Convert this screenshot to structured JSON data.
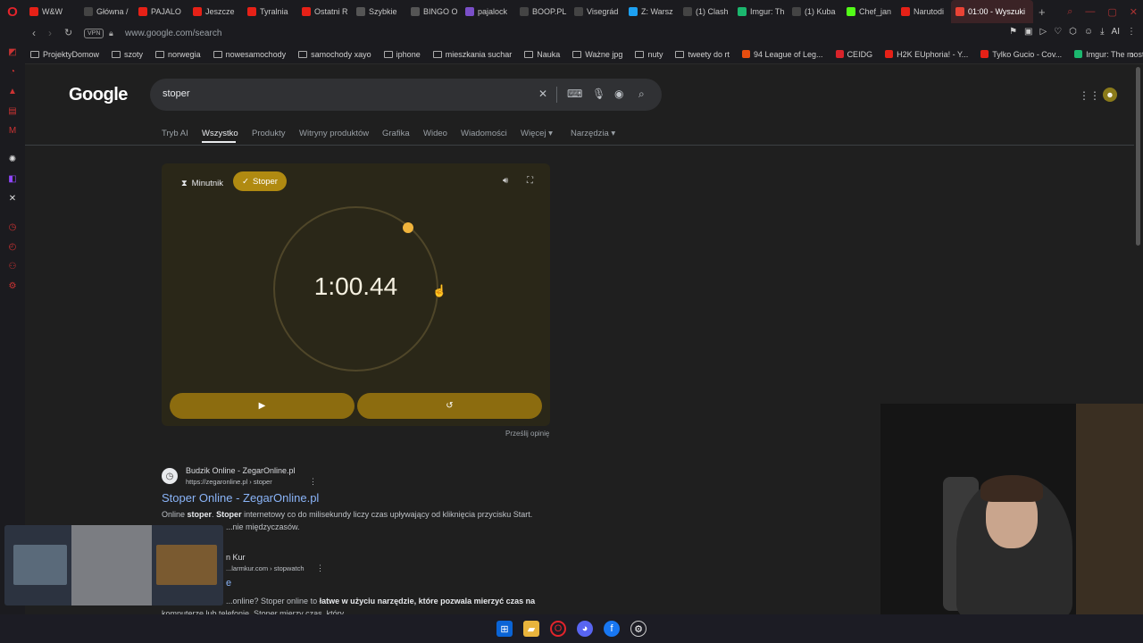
{
  "browser": {
    "tabs": [
      {
        "label": "W&W",
        "color": "#e62117",
        "icon": "youtube-icon"
      },
      {
        "label": "Główna /",
        "color": "#444",
        "icon": "x-icon"
      },
      {
        "label": "PAJALO",
        "color": "#e62117",
        "icon": "youtube-icon"
      },
      {
        "label": "Jeszcze",
        "color": "#e62117",
        "icon": "youtube-icon"
      },
      {
        "label": "Tyralnia",
        "color": "#e62117",
        "icon": "youtube-icon"
      },
      {
        "label": "Ostatni R",
        "color": "#e62117",
        "icon": "youtube-icon"
      },
      {
        "label": "Szybkie",
        "color": "#555",
        "icon": "page-icon"
      },
      {
        "label": "BINGO O",
        "color": "#555",
        "icon": "page-icon"
      },
      {
        "label": "pajalock",
        "color": "#7a4fc8",
        "icon": "twitch-icon"
      },
      {
        "label": "BOOP.PL",
        "color": "#444",
        "icon": "x-icon"
      },
      {
        "label": "Visegrád",
        "color": "#444",
        "icon": "x-icon"
      },
      {
        "label": "Z: Warsz",
        "color": "#1da1f2",
        "icon": "z-icon"
      },
      {
        "label": "(1) Clash",
        "color": "#444",
        "icon": "x-icon"
      },
      {
        "label": "Imgur: Th",
        "color": "#1bb76e",
        "icon": "imgur-icon"
      },
      {
        "label": "(1) Kuba",
        "color": "#444",
        "icon": "x-icon"
      },
      {
        "label": "Chef_jan",
        "color": "#53fc18",
        "icon": "kick-icon"
      },
      {
        "label": "Narutodi",
        "color": "#e62117",
        "icon": "youtube-icon"
      },
      {
        "label": "01:00 - Wyszuki",
        "color": "#ea4335",
        "icon": "google-icon",
        "active": true
      }
    ],
    "url": "www.google.com/search",
    "vpn_label": "VPN",
    "bookmarks": [
      {
        "label": "ProjektyDomow",
        "type": "folder"
      },
      {
        "label": "szoty",
        "type": "folder"
      },
      {
        "label": "norwegia",
        "type": "folder"
      },
      {
        "label": "nowesamochody",
        "type": "folder"
      },
      {
        "label": "samochody xayo",
        "type": "folder"
      },
      {
        "label": "iphone",
        "type": "folder"
      },
      {
        "label": "mieszkania suchar",
        "type": "folder"
      },
      {
        "label": "Nauka",
        "type": "folder"
      },
      {
        "label": "Ważne jpg",
        "type": "folder"
      },
      {
        "label": "nuty",
        "type": "folder"
      },
      {
        "label": "tweety do rt",
        "type": "folder"
      },
      {
        "label": "94 League of Leg...",
        "type": "link",
        "color": "#e84e0f"
      },
      {
        "label": "CEIDG",
        "type": "link",
        "color": "#d8232a"
      },
      {
        "label": "H2K EUphoria! - Y...",
        "type": "link",
        "color": "#e62117"
      },
      {
        "label": "Tylko Gucio - Cov...",
        "type": "link",
        "color": "#e62117"
      },
      {
        "label": "Imgur: The most a...",
        "type": "link",
        "color": "#1bb76e"
      }
    ]
  },
  "google": {
    "logo": "Google",
    "query": "stoper",
    "tabs": [
      "Tryb AI",
      "Wszystko",
      "Produkty",
      "Witryny produktów",
      "Grafika",
      "Wideo",
      "Wiadomości",
      "Więcej",
      "Narzędzia"
    ],
    "active_tab": "Wszystko"
  },
  "stopwatch": {
    "timer_label": "Minutnik",
    "stopwatch_label": "Stoper",
    "time": "1:00.44",
    "feedback": "Prześlij opinię",
    "accent": "#b08a11"
  },
  "results": [
    {
      "site": "Budzik Online - ZegarOnline.pl",
      "url": "https://zegaronline.pl › stoper",
      "title": "Stoper Online - ZegarOnline.pl",
      "snippet_pre": "Online ",
      "snippet_b1": "stoper",
      "snippet_mid": ". ",
      "snippet_b2": "Stoper",
      "snippet_post": " internetowy co do milisekundy liczy czas upływający od kliknięcia przycisku Start.",
      "snippet_line2": "...nie międzyczasów."
    },
    {
      "site": "n Kur",
      "url": "...larmkur.com › stopwatch",
      "title": "e",
      "snippet_pre": "...online? Stoper online to ",
      "snippet_b1": "łatwe w użyciu narzędzie, które pozwala mierzyć czas na",
      "snippet_line2": "komputerze lub telefonie. Stoper mierzy czas, który..."
    }
  ]
}
